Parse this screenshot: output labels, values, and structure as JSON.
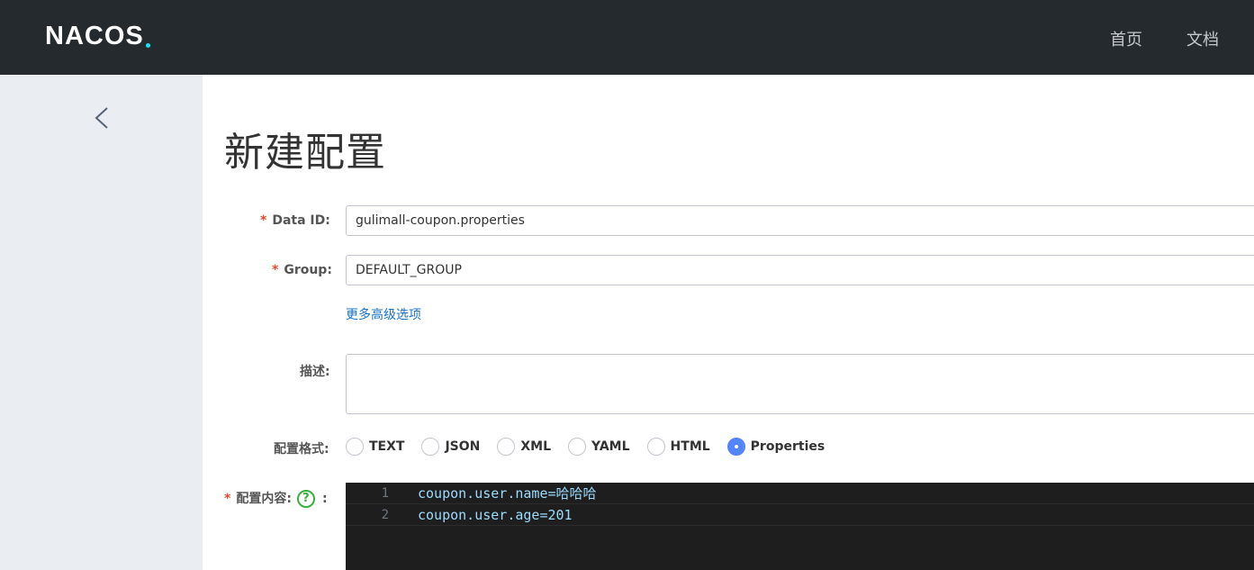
{
  "header": {
    "logo": "NACOS",
    "nav": {
      "home": "首页",
      "docs": "文档"
    }
  },
  "page": {
    "title": "新建配置"
  },
  "form": {
    "data_id": {
      "required": "*",
      "label": "Data ID:",
      "value": "gulimall-coupon.properties"
    },
    "group": {
      "required": "*",
      "label": "Group:",
      "value": "DEFAULT_GROUP"
    },
    "advanced_link": "更多高级选项",
    "description": {
      "label": "描述:",
      "value": ""
    },
    "format": {
      "label": "配置格式:",
      "options": [
        "TEXT",
        "JSON",
        "XML",
        "YAML",
        "HTML",
        "Properties"
      ],
      "selected": "Properties"
    },
    "content": {
      "required": "*",
      "label": "配置内容:",
      "help": "?",
      "colon": ":",
      "lines": [
        {
          "num": "1",
          "text": "coupon.user.name=哈哈哈"
        },
        {
          "num": "2",
          "text": "coupon.user.age=201"
        }
      ]
    }
  },
  "colors": {
    "topbar": "#252a2f",
    "sidebar": "#eaedf1",
    "accent": "#5584ff",
    "link": "#1a73c8",
    "required": "#e8472a"
  },
  "icons": {
    "back": "chevron-left-icon",
    "help": "question-circle-icon"
  }
}
